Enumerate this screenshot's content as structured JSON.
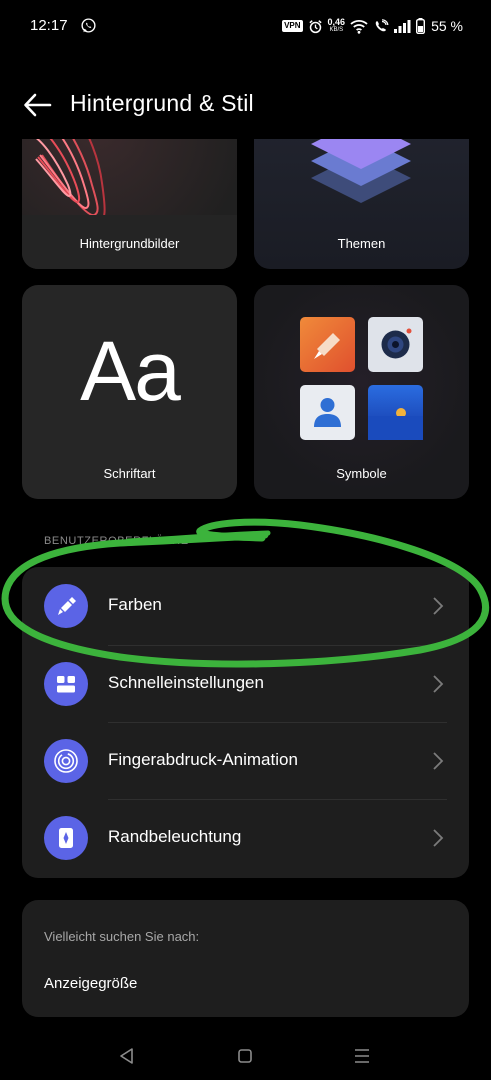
{
  "status_bar": {
    "time": "12:17",
    "vpn": "VPN",
    "speed_value": "0,46",
    "speed_unit": "KB/S",
    "battery": "55 %"
  },
  "header": {
    "title": "Hintergrund & Stil"
  },
  "tiles": {
    "wallpaper": "Hintergrundbilder",
    "themes": "Themen",
    "font": "Schriftart",
    "font_glyph": "Aa",
    "symbols": "Symbole"
  },
  "section": {
    "title": "BENUTZEROBERFLÄCHE",
    "items": [
      {
        "label": "Farben",
        "icon": "brush-icon"
      },
      {
        "label": "Schnelleinstellungen",
        "icon": "quick-settings-icon"
      },
      {
        "label": "Fingerabdruck-Animation",
        "icon": "fingerprint-icon"
      },
      {
        "label": "Randbeleuchtung",
        "icon": "edge-light-icon"
      }
    ]
  },
  "suggestions": {
    "title": "Vielleicht suchen Sie nach:",
    "item": "Anzeigegröße"
  },
  "colors": {
    "accent": "#5b64e6",
    "annotation": "#3cb33c"
  }
}
